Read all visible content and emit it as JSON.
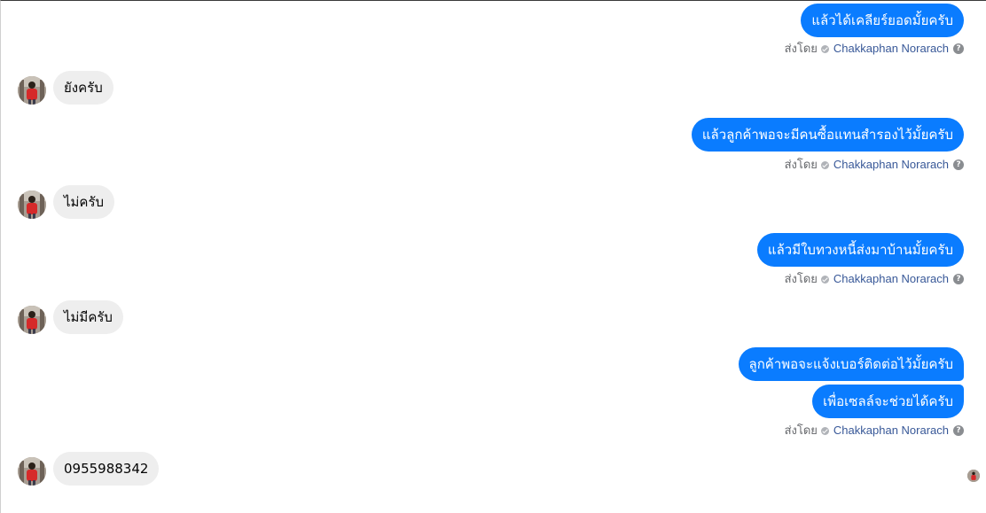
{
  "conversation": {
    "sent_by": {
      "prefix": "ส่งโดย",
      "name": "Chakkaphan Norarach",
      "help": "?"
    },
    "messages": [
      {
        "direction": "outgoing",
        "text": "แล้วได้เคลียร์ยอดมั้ยครับ"
      },
      {
        "direction": "incoming",
        "text": "ยังครับ"
      },
      {
        "direction": "outgoing",
        "text": "แล้วลูกค้าพอจะมีคนซื้อแทนสำรองไว้มั้ยครับ"
      },
      {
        "direction": "incoming",
        "text": "ไม่ครับ"
      },
      {
        "direction": "outgoing",
        "text": "แล้วมีใบทวงหนี้ส่งมาบ้านมั้ยครับ"
      },
      {
        "direction": "incoming",
        "text": "ไม่มีครับ"
      },
      {
        "direction": "outgoing",
        "text": "ลูกค้าพอจะแจ้งเบอร์ติดต่อไว้มั้ยครับ"
      },
      {
        "direction": "outgoing",
        "text": "เพื่อเซลล์จะช่วยได้ครับ"
      },
      {
        "direction": "incoming",
        "text": "0955988342"
      }
    ]
  },
  "colors": {
    "outgoing_bubble": "#0a7cff",
    "incoming_bubble": "#eeeeee",
    "sender_name_link": "#385898",
    "meta_text": "#65676b"
  },
  "icons": {
    "avatar": "user-avatar",
    "verified": "verified-check-icon",
    "help": "help-circle-icon",
    "seen": "seen-avatar"
  }
}
